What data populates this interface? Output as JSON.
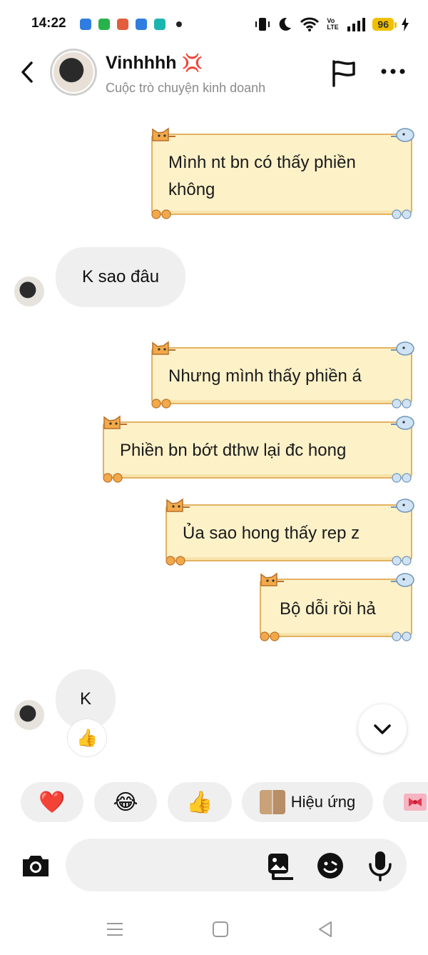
{
  "status_bar": {
    "time": "14:22",
    "battery": "96",
    "network": "Vo LTE"
  },
  "header": {
    "name": "Vinhhhh",
    "name_emoji": "💢",
    "subtitle": "Cuộc trò chuyện kinh doanh"
  },
  "messages": [
    {
      "side": "sent",
      "text_line1": "Mình nt bn có thấy phiền",
      "text_line2": "không"
    },
    {
      "side": "received",
      "text": "K sao đâu"
    },
    {
      "side": "sent",
      "text": "Nhưng mình thấy phiền á"
    },
    {
      "side": "sent",
      "text": "Phiền bn bớt dthw lại đc hong"
    },
    {
      "side": "sent",
      "text": "Ủa sao hong thấy rep z"
    },
    {
      "side": "sent",
      "text": "Bộ dỗi rồi hả"
    },
    {
      "side": "received",
      "text": "K",
      "reaction": "👍"
    }
  ],
  "quick_reactions": {
    "heart": "❤️",
    "laugh": "😂",
    "thumbs": "👍",
    "effects_label": "Hiệu ứng"
  },
  "colors": {
    "bubble_fill": "#fdf1c8",
    "bubble_border": "#e3b261",
    "received_bg": "#efefef"
  }
}
